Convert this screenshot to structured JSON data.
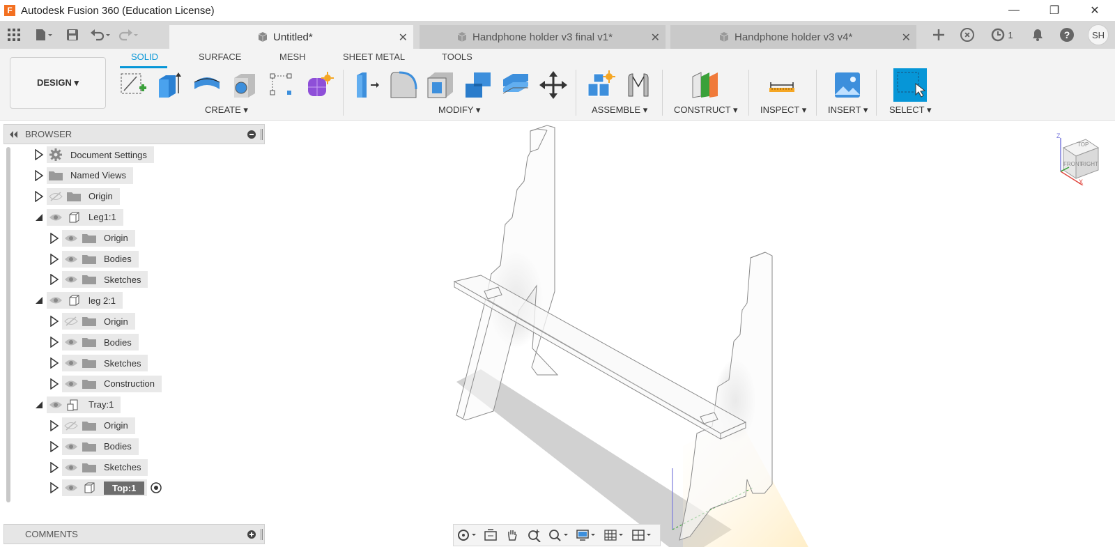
{
  "window": {
    "app_logo": "F",
    "title": "Autodesk Fusion 360 (Education License)",
    "controls": [
      "—",
      "❐",
      "✕"
    ]
  },
  "tabs": {
    "documents": [
      {
        "label": "Untitled*",
        "active": true
      },
      {
        "label": "Handphone holder v3 final v1*",
        "active": false
      },
      {
        "label": "Handphone holder v3 v4*",
        "active": false
      }
    ],
    "job_count": "1",
    "user_initials": "SH"
  },
  "ribbon": {
    "workspace": "DESIGN ▾",
    "tabs": [
      "SOLID",
      "SURFACE",
      "MESH",
      "SHEET METAL",
      "TOOLS"
    ],
    "active_tab": "SOLID",
    "groups": [
      "CREATE ▾",
      "MODIFY ▾",
      "ASSEMBLE ▾",
      "CONSTRUCT ▾",
      "INSPECT ▾",
      "INSERT ▾",
      "SELECT ▾"
    ],
    "accent_color": "#0696d7"
  },
  "browser": {
    "title": "BROWSER",
    "items": [
      {
        "label": "Document Settings",
        "icon": "gear-icon",
        "visibility": "none"
      },
      {
        "label": "Named Views",
        "icon": "folder-icon",
        "visibility": "none"
      },
      {
        "label": "Origin",
        "icon": "folder-icon",
        "visibility": "hidden"
      },
      {
        "label": "Leg1:1",
        "icon": "component-icon",
        "visibility": "visible",
        "expanded": true
      },
      {
        "label": "Origin",
        "icon": "folder-icon",
        "visibility": "visible"
      },
      {
        "label": "Bodies",
        "icon": "folder-icon",
        "visibility": "visible"
      },
      {
        "label": "Sketches",
        "icon": "folder-icon",
        "visibility": "visible"
      },
      {
        "label": "leg 2:1",
        "icon": "component-icon",
        "visibility": "visible",
        "expanded": true
      },
      {
        "label": "Origin",
        "icon": "folder-icon",
        "visibility": "hidden"
      },
      {
        "label": "Bodies",
        "icon": "folder-icon",
        "visibility": "visible"
      },
      {
        "label": "Sketches",
        "icon": "folder-icon",
        "visibility": "visible"
      },
      {
        "label": "Construction",
        "icon": "folder-icon",
        "visibility": "visible"
      },
      {
        "label": "Tray:1",
        "icon": "linked-component-icon",
        "visibility": "visible",
        "expanded": true
      },
      {
        "label": "Origin",
        "icon": "folder-icon",
        "visibility": "hidden"
      },
      {
        "label": "Bodies",
        "icon": "folder-icon",
        "visibility": "visible"
      },
      {
        "label": "Sketches",
        "icon": "folder-icon",
        "visibility": "visible"
      },
      {
        "label": "Top:1",
        "icon": "component-icon",
        "visibility": "visible",
        "selected": true
      }
    ]
  },
  "comments": {
    "title": "COMMENTS"
  },
  "viewcube": {
    "top_label": "TOP",
    "front_label": "FRONT",
    "right_label": "RIGHT",
    "axis_z": "Z",
    "axis_x": "X"
  }
}
